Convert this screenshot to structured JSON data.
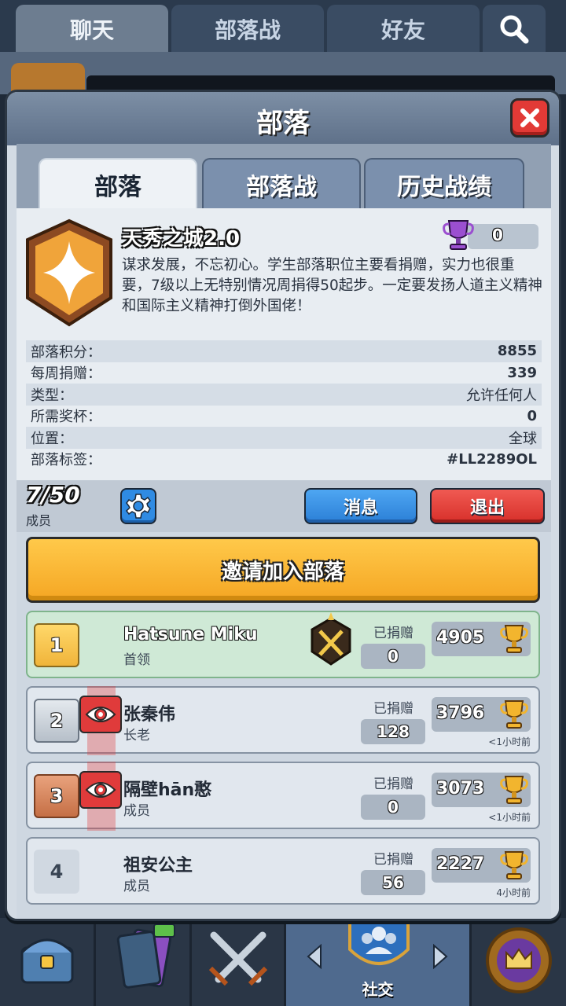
{
  "top_tabs": [
    {
      "label": "聊天"
    },
    {
      "label": "部落战"
    },
    {
      "label": "好友"
    }
  ],
  "dialog": {
    "title": "部落",
    "tabs": [
      {
        "label": "部落"
      },
      {
        "label": "部落战"
      },
      {
        "label": "历史战绩"
      }
    ]
  },
  "clan": {
    "name": "天秀之城2.0",
    "trophies": "0",
    "description": "谋求发展，不忘初心。学生部落职位主要看捐赠，实力也很重要，7级以上无特别情况周捐得50起步。一定要发扬人道主义精神和国际主义精神打倒外国佬！",
    "stats": [
      {
        "label": "部落积分：",
        "value": "8855"
      },
      {
        "label": "每周捐赠：",
        "value": "339"
      },
      {
        "label": "类型：",
        "value": "允许任何人"
      },
      {
        "label": "所需奖杯：",
        "value": "0"
      },
      {
        "label": "位置：",
        "value": "全球"
      },
      {
        "label": "部落标签：",
        "value": "#LL2289OL"
      }
    ]
  },
  "members_bar": {
    "count": "7/50",
    "label": "成员",
    "message_button": "消息",
    "leave_button": "退出"
  },
  "invite_button": "邀请加入部落",
  "members": [
    {
      "rank": "1",
      "name": "Hatsune Miku",
      "role": "首领",
      "donated_label": "已捐赠",
      "donated": "0",
      "trophies": "4905",
      "last_seen": ""
    },
    {
      "rank": "2",
      "name": "张秦伟",
      "role": "长老",
      "donated_label": "已捐赠",
      "donated": "128",
      "trophies": "3796",
      "last_seen": "<1小时前"
    },
    {
      "rank": "3",
      "name": "隔壁hān憨",
      "role": "成员",
      "donated_label": "已捐赠",
      "donated": "0",
      "trophies": "3073",
      "last_seen": "<1小时前"
    },
    {
      "rank": "4",
      "name": "祖安公主",
      "role": "成员",
      "donated_label": "已捐赠",
      "donated": "56",
      "trophies": "2227",
      "last_seen": "4小时前"
    }
  ],
  "bottom_nav": {
    "active_label": "社交"
  },
  "colors": {
    "accent_blue": "#2f8be3",
    "accent_red": "#e23a36",
    "invite_gold": "#f5a623"
  },
  "icons": [
    "search-icon",
    "close-icon",
    "gear-icon",
    "trophy-icon",
    "eye-icon",
    "chest-icon",
    "cards-icon",
    "swords-icon",
    "clan-icon",
    "arrow-left-icon",
    "arrow-right-icon",
    "crown-icon"
  ]
}
